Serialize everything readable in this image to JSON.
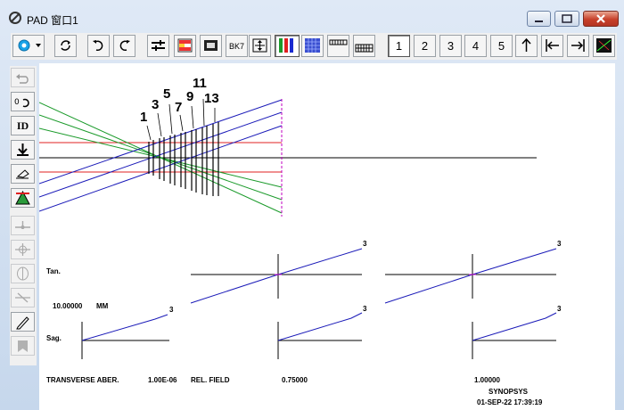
{
  "window": {
    "title": "PAD 窗口1"
  },
  "toolbar": {
    "glass_label": "BK7",
    "number_buttons": [
      "1",
      "2",
      "3",
      "4",
      "5"
    ]
  },
  "sidebar": {
    "id_label": "ID"
  },
  "lens": {
    "surface_labels": [
      "1",
      "3",
      "5",
      "7",
      "9",
      "11",
      "13"
    ]
  },
  "aberration": {
    "tan_label": "Tan.",
    "sag_label": "Sag.",
    "scale_label": "10.00000",
    "scale_unit": "MM",
    "curve_label": "3",
    "footer_title": "TRANSVERSE ABER.",
    "footer_wavelength": "1.00E-06",
    "footer_relfield": "REL. FIELD",
    "field_values": [
      "0.75000",
      "1.00000"
    ],
    "company": "SYNOPSYS",
    "timestamp": "01-SEP-22  17:39:19"
  }
}
